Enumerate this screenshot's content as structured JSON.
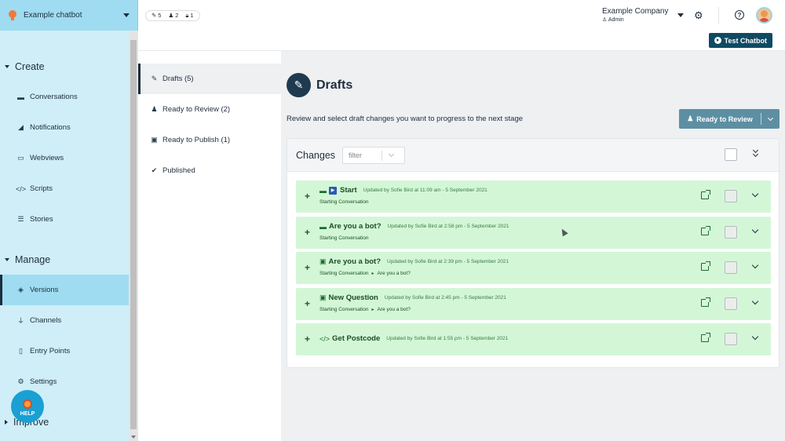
{
  "app": {
    "chatbot_name": "Example chatbot"
  },
  "topbar": {
    "stats": [
      {
        "icon": "drafts-icon",
        "count": "5"
      },
      {
        "icon": "review-icon",
        "count": "2"
      },
      {
        "icon": "lock-icon",
        "count": "1"
      }
    ],
    "company": "Example Company",
    "role": "Admin",
    "test_button": "Test Chatbot"
  },
  "sidebar": {
    "sections": [
      {
        "label": "Create",
        "items": [
          "Conversations",
          "Notifications",
          "Webviews",
          "Scripts",
          "Stories"
        ]
      },
      {
        "label": "Manage",
        "items": [
          "Versions",
          "Channels",
          "Entry Points",
          "Settings"
        ]
      },
      {
        "label": "Improve",
        "items": []
      }
    ],
    "active_item": "Versions",
    "help_label": "HELP"
  },
  "stages": [
    {
      "label": "Drafts (5)",
      "icon": "pencil-ruler-icon",
      "active": true
    },
    {
      "label": "Ready to Review (2)",
      "icon": "people-icon",
      "active": false
    },
    {
      "label": "Ready to Publish (1)",
      "icon": "lock-icon",
      "active": false
    },
    {
      "label": "Published",
      "icon": "double-check-icon",
      "active": false
    }
  ],
  "main": {
    "title": "Drafts",
    "subtitle": "Review and select draft changes you want to progress to the next stage",
    "review_button": "Ready to Review",
    "changes_label": "Changes",
    "filter_placeholder": "filter",
    "rows": [
      {
        "title": "Start",
        "meta": "Updated by Sofie Bird at 11:09 am - 5 September 2021",
        "crumbs": [
          "Starting Conversation"
        ],
        "icon": "chat-icon"
      },
      {
        "title": "Are you a bot?",
        "meta": "Updated by Sofie Bird at 2:58 pm - 5 September 2021",
        "crumbs": [
          "Starting Conversation"
        ],
        "icon": "chat-icon"
      },
      {
        "title": "Are you a bot?",
        "meta": "Updated by Sofie Bird at 2:39 pm - 5 September 2021",
        "crumbs": [
          "Starting Conversation",
          "Are you a bot?"
        ],
        "icon": "question-icon"
      },
      {
        "title": "New Question",
        "meta": "Updated by Sofie Bird at 2:45 pm - 5 September 2021",
        "crumbs": [
          "Starting Conversation",
          "Are you a bot?"
        ],
        "icon": "question-icon"
      },
      {
        "title": "Get Postcode",
        "meta": "Updated by Sofie Bird at 1:55 pm - 5 September 2021",
        "crumbs": [],
        "icon": "code-icon"
      }
    ]
  },
  "colors": {
    "sidebar_bg": "#cfeef8",
    "sidebar_active": "#9fdcf1",
    "row_bg": "#d3f7d6",
    "primary_dark": "#0f4a63",
    "review_button": "#5d8fa3"
  }
}
